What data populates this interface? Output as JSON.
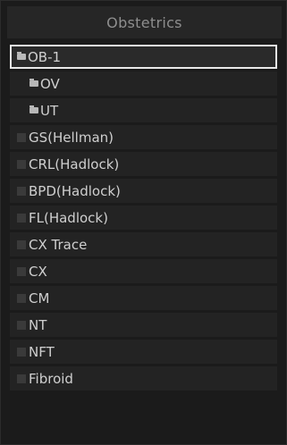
{
  "panel": {
    "title": "Obstetrics"
  },
  "items": [
    {
      "label": "OB-1",
      "icon": "folder-icon"
    },
    {
      "label": "OV",
      "icon": "folder-icon"
    },
    {
      "label": "UT",
      "icon": "folder-icon"
    },
    {
      "label": "GS(Hellman)",
      "icon": "item-icon"
    },
    {
      "label": "CRL(Hadlock)",
      "icon": "item-icon"
    },
    {
      "label": "BPD(Hadlock)",
      "icon": "item-icon"
    },
    {
      "label": "FL(Hadlock)",
      "icon": "item-icon"
    },
    {
      "label": "CX Trace",
      "icon": "item-icon"
    },
    {
      "label": "CX",
      "icon": "item-icon"
    },
    {
      "label": "CM",
      "icon": "item-icon"
    },
    {
      "label": "NT",
      "icon": "item-icon"
    },
    {
      "label": "NFT",
      "icon": "item-icon"
    },
    {
      "label": "Fibroid",
      "icon": "item-icon"
    }
  ],
  "selected_item": "OB-1"
}
